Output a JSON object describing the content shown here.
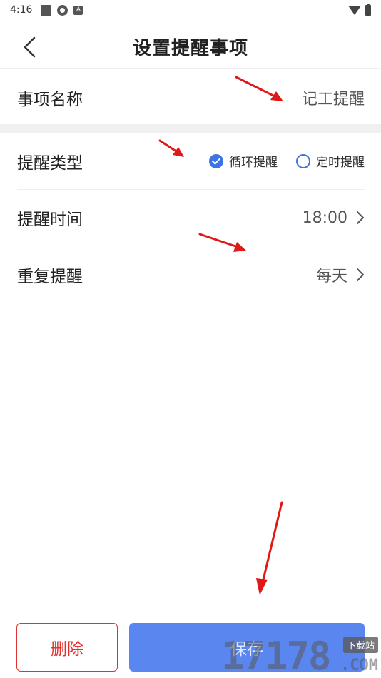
{
  "status_bar": {
    "time": "4:16",
    "icons": [
      "square-icon",
      "pinwheel-icon",
      "a-badge-icon"
    ],
    "right_icons": [
      "wifi-icon",
      "battery-icon"
    ]
  },
  "nav": {
    "title": "设置提醒事项",
    "back_icon": "chevron-left-icon"
  },
  "form": {
    "item_name": {
      "label": "事项名称",
      "value": "记工提醒"
    },
    "remind_type": {
      "label": "提醒类型",
      "options": [
        {
          "label": "循环提醒",
          "selected": true
        },
        {
          "label": "定时提醒",
          "selected": false
        }
      ]
    },
    "remind_time": {
      "label": "提醒时间",
      "value": "18:00"
    },
    "repeat": {
      "label": "重复提醒",
      "value": "每天"
    }
  },
  "footer": {
    "delete_label": "删除",
    "save_label": "保存"
  },
  "watermark": {
    "digits": "17178",
    "badge": "下载站",
    "suffix": ".COM"
  },
  "colors": {
    "accent": "#3a74e8",
    "save_button": "#5a86f0",
    "delete": "#e0322f",
    "annotation_arrow": "#e01818"
  }
}
